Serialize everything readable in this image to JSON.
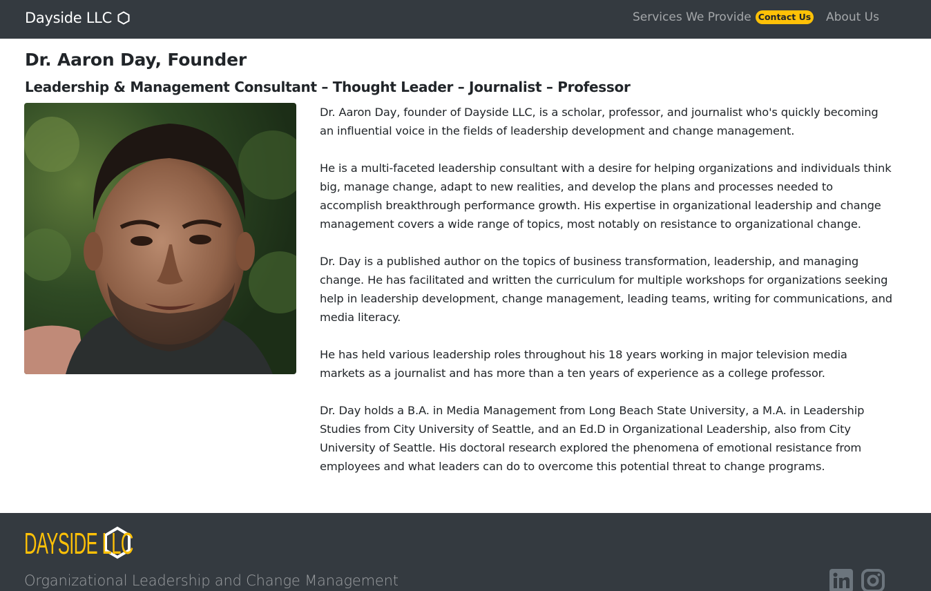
{
  "navbar": {
    "brand": "Dayside LLC",
    "brand_icon": "hexagon-icon",
    "links": {
      "services": "Services We Provide",
      "contact": "Contact Us",
      "about": "About Us"
    }
  },
  "colors": {
    "navbar_bg": "#343a40",
    "accent": "#ffc107",
    "footer_bg": "#343a40"
  },
  "main": {
    "title": "Dr. Aaron Day, Founder",
    "subtitle": "Leadership & Management Consultant – Thought Leader – Journalist – Professor",
    "paragraphs": [
      "Dr. Aaron Day, founder of Dayside LLC, is a scholar, professor, and journalist who's quickly becoming an influential voice in the fields of leadership development and change management.",
      "He is a multi-faceted leadership consultant with a desire for helping organizations and individuals think big, manage change, adapt to new realities, and develop the plans and processes needed to accomplish breakthrough performance growth. His expertise in organizational leadership and change management covers a wide range of topics, most notably on resistance to organizational change.",
      "Dr. Day is a published author on the topics of business transformation, leadership, and managing change. He has facilitated and written the curriculum for multiple workshops for organizations seeking help in leadership development, change management, leading teams, writing for communications, and media literacy.",
      "He has held various leadership roles throughout his 18 years working in major television media markets as a journalist and has more than a ten years of experience as a college professor.",
      "Dr. Day holds a B.A. in Media Management from Long Beach State University, a M.A. in Leadership Studies from City University of Seattle, and an Ed.D in Organizational Leadership, also from City University of Seattle. His doctoral research explored the phenomena of emotional resistance from employees and what leaders can do to overcome this potential threat to change programs."
    ]
  },
  "footer": {
    "logo_text": "DAYSIDE LLC",
    "logo_icon": "hexagon-icon",
    "tagline": "Organizational Leadership and Change Management",
    "social": [
      "linkedin-icon",
      "instagram-icon"
    ]
  }
}
